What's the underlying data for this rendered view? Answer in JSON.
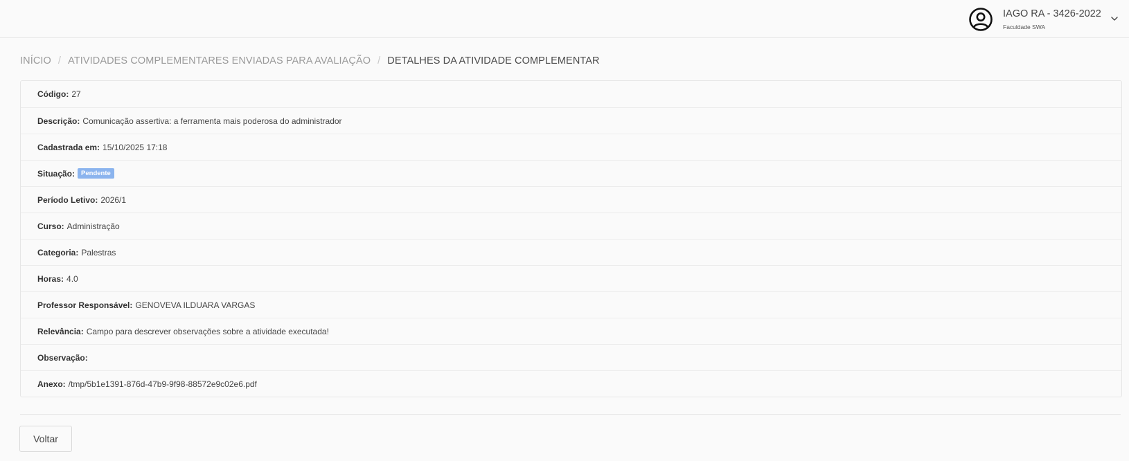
{
  "header": {
    "user_name": "IAGO RA - 3426-2022",
    "user_org": "Faculdade SWA",
    "avatar_icon": "user-circle-icon",
    "menu_icon": "chevron-down-icon"
  },
  "breadcrumb": {
    "items": [
      "INÍCIO",
      "ATIVIDADES COMPLEMENTARES ENVIADAS PARA AVALIAÇÃO",
      "DETALHES DA ATIVIDADE COMPLEMENTAR"
    ],
    "separator": "/"
  },
  "details": {
    "rows": [
      {
        "label": "Código:",
        "value": "27"
      },
      {
        "label": "Descrição:",
        "value": "Comunicação assertiva: a ferramenta mais poderosa do administrador"
      },
      {
        "label": "Cadastrada em:",
        "value": "15/10/2025 17:18"
      },
      {
        "label": "Situação:",
        "value": "",
        "badge": "Pendente"
      },
      {
        "label": "Período Letivo:",
        "value": "2026/1"
      },
      {
        "label": "Curso:",
        "value": "Administração"
      },
      {
        "label": "Categoria:",
        "value": "Palestras"
      },
      {
        "label": "Horas:",
        "value": "4.0"
      },
      {
        "label": "Professor Responsável:",
        "value": "GENOVEVA ILDUARA VARGAS"
      },
      {
        "label": "Relevância:",
        "value": "Campo para descrever observações sobre a atividade executada!"
      },
      {
        "label": "Observação:",
        "value": ""
      },
      {
        "label": "Anexo:",
        "value": "/tmp/5b1e1391-876d-47b9-9f98-88572e9c02e6.pdf"
      }
    ]
  },
  "actions": {
    "back_label": "Voltar"
  },
  "colors": {
    "badge_pending": "#8bb4ee",
    "background": "#fafafa"
  }
}
